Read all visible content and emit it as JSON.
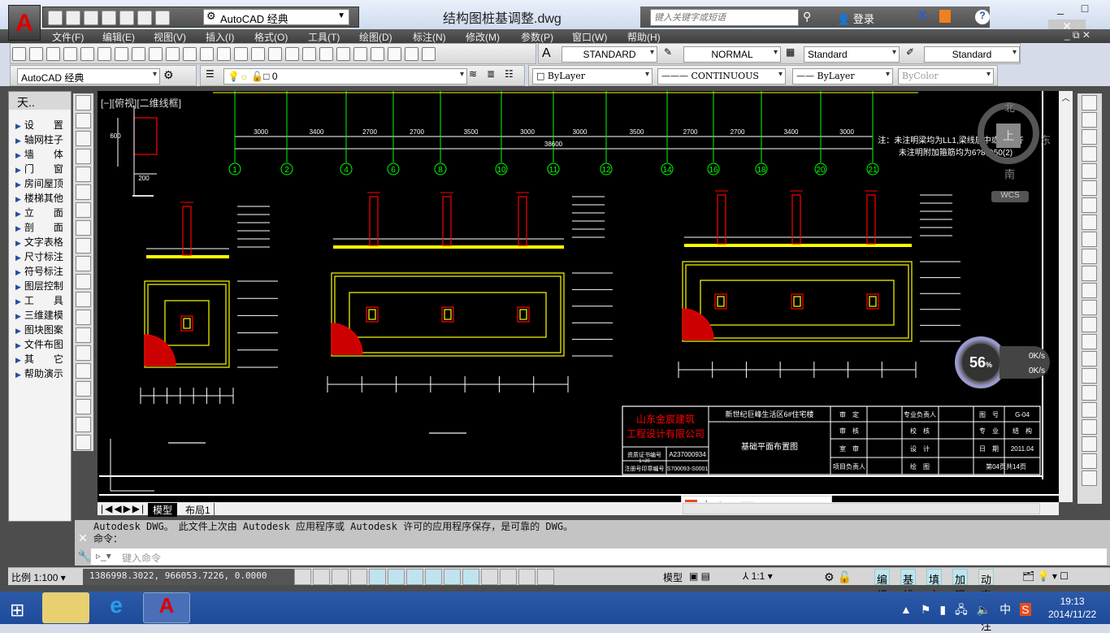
{
  "window": {
    "title": "结构图桩基调整.dwg",
    "app_logo": "A",
    "workspace": "AutoCAD 经典",
    "search_placeholder": "键入关键字或短语",
    "login": "登录",
    "minimize": "_",
    "maximize": "□",
    "close": "✕"
  },
  "menu": [
    "文件(F)",
    "编辑(E)",
    "视图(V)",
    "插入(I)",
    "格式(O)",
    "工具(T)",
    "绘图(D)",
    "标注(N)",
    "修改(M)",
    "参数(P)",
    "窗口(W)",
    "帮助(H)"
  ],
  "styles": {
    "text_style": "STANDARD",
    "dim_style": "NORMAL",
    "table_style": "Standard",
    "mleader_style": "Standard"
  },
  "layers": {
    "workspace": "AutoCAD 经典",
    "current_layer": "0",
    "color": "ByLayer",
    "linetype": "CONTINUOUS",
    "lineweight": "ByLayer",
    "plotstyle": "ByColor"
  },
  "palette": {
    "title": "天..",
    "items": [
      "设　　置",
      "轴网柱子",
      "墙　　体",
      "门　　窗",
      "房间屋顶",
      "楼梯其他",
      "立　　面",
      "剖　　面",
      "文字表格",
      "尺寸标注",
      "符号标注",
      "图层控制",
      "工　　具",
      "三维建模",
      "图块图案",
      "文件布图",
      "其　　它",
      "帮助演示"
    ]
  },
  "viewport": {
    "label": "[−][俯视][二维线框]",
    "viewcube": {
      "north": "北",
      "south": "南",
      "east": "东",
      "top": "上",
      "wcs": "WCS"
    }
  },
  "drawing": {
    "axes": [
      "1",
      "2",
      "4",
      "6",
      "8",
      "10",
      "11",
      "12",
      "14",
      "16",
      "18",
      "20",
      "21"
    ],
    "dimensions": [
      "3000",
      "3400",
      "2700",
      "2700",
      "3500",
      "3000",
      "3000",
      "3500",
      "2700",
      "2700",
      "3400",
      "3000"
    ],
    "total": "38600",
    "detail_dims": {
      "height": "600",
      "width": "200"
    },
    "notes": [
      "注：未注明梁均为LL1,梁线居中或与柱齐",
      "未注明附加箍筋均为6?8@50(2)"
    ],
    "titleblock": {
      "company": [
        "山东金宸建筑",
        "工程设计有限公司"
      ],
      "project": "新世纪巨峰生活区6#住宅楼",
      "drawing_name": "基础平面布置图",
      "cert_label": "资质证书编号",
      "cert_value": "A237000934",
      "cert_grade": "1+20",
      "reg_label": "注册号印章编号",
      "reg_value": "S700093-S0001",
      "cells": [
        "审　定",
        "",
        "专业负责人",
        "",
        "图　号",
        "G-04",
        "审　核",
        "",
        "校　核",
        "",
        "专　业",
        "结　构",
        "室　审",
        "",
        "设　计",
        "",
        "日　期",
        "2011.04",
        "项目负责人",
        "",
        "绘　图",
        "",
        "第04页共14页"
      ]
    }
  },
  "netmeter": {
    "percent": "56",
    "unit": "%",
    "up": "0K/s",
    "down": "0K/s"
  },
  "ime": {
    "label": "中"
  },
  "tabs": [
    "模型",
    "布局1"
  ],
  "command": {
    "history": [
      "Autodesk DWG。　此文件上次由 Autodesk 应用程序或 Autodesk 许可的应用程序保存，是可靠的 DWG。",
      "命令："
    ],
    "placeholder": "键入命令"
  },
  "status": {
    "scale": "比例 1:100",
    "coords": "1386998.3022, 966053.7226, 0.0000",
    "model": "模型",
    "anno_scale": "1:1",
    "toggles": [
      "编组",
      "基线",
      "填充",
      "加粗",
      "动态标注"
    ]
  },
  "taskbar": {
    "time": "19:13",
    "date": "2014/11/22",
    "ime": "中"
  },
  "colors": {
    "canvas": "#000000",
    "axis": "#00ff00",
    "column": "#ff0000",
    "outline": "#ffff00",
    "dim": "#ffffff",
    "taskbar": "#1f4e9e"
  }
}
